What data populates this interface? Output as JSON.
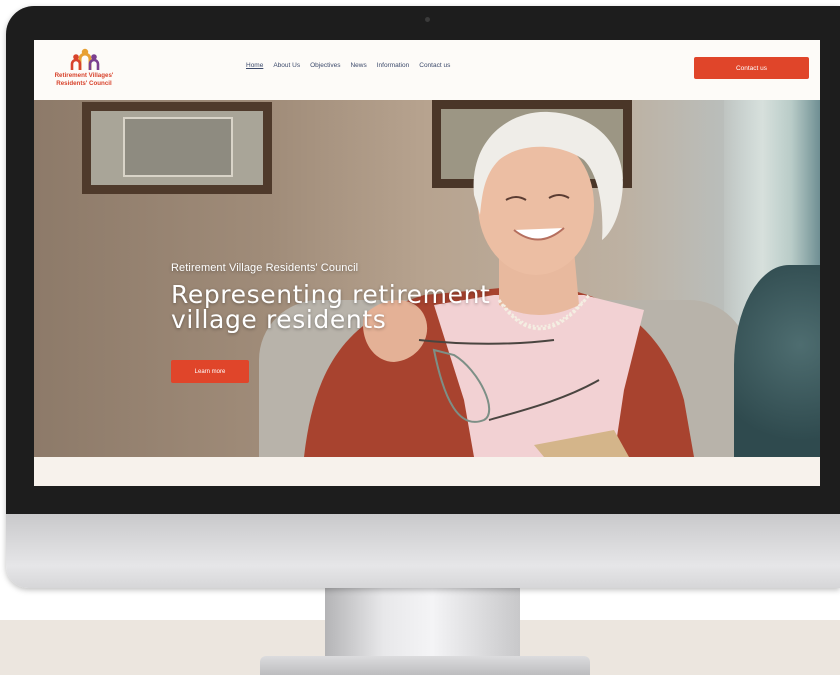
{
  "header": {
    "logo_text_line1": "Retirement Villages'",
    "logo_text_line2": "Residents' Council",
    "nav": [
      {
        "label": "Home",
        "active": true
      },
      {
        "label": "About Us"
      },
      {
        "label": "Objectives"
      },
      {
        "label": "News"
      },
      {
        "label": "Information"
      },
      {
        "label": "Contact us"
      }
    ],
    "cta_label": "Contact us"
  },
  "hero": {
    "kicker": "Retirement Village Residents' Council",
    "title": "Representing retirement village residents",
    "button_label": "Learn more"
  },
  "colors": {
    "accent": "#e0452a",
    "nav_text": "#3c4a6b",
    "header_bg": "#fdfbf8"
  },
  "icons": {
    "logo": "family-figures-logo-icon"
  }
}
